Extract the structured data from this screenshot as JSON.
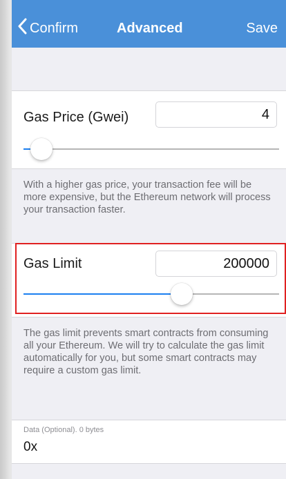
{
  "navbar": {
    "back_label": "Confirm",
    "title": "Advanced",
    "save_label": "Save",
    "color": "#4a90d9"
  },
  "gas_price": {
    "label": "Gas Price (Gwei)",
    "value": "4",
    "slider_fraction": 0.07,
    "help": "With a higher gas price, your transaction fee will be more expensive, but the Ethereum network will process your transaction faster."
  },
  "gas_limit": {
    "label": "Gas Limit",
    "value": "200000",
    "slider_fraction": 0.62,
    "help": "The gas limit prevents smart contracts from consuming all your Ethereum. We will try to calculate the gas limit automatically for you, but some smart contracts may require a custom gas limit.",
    "highlight_color": "#e02020"
  },
  "data_field": {
    "label": "Data (Optional). 0 bytes",
    "value": "0x"
  },
  "accent_color": "#1a7ef0"
}
